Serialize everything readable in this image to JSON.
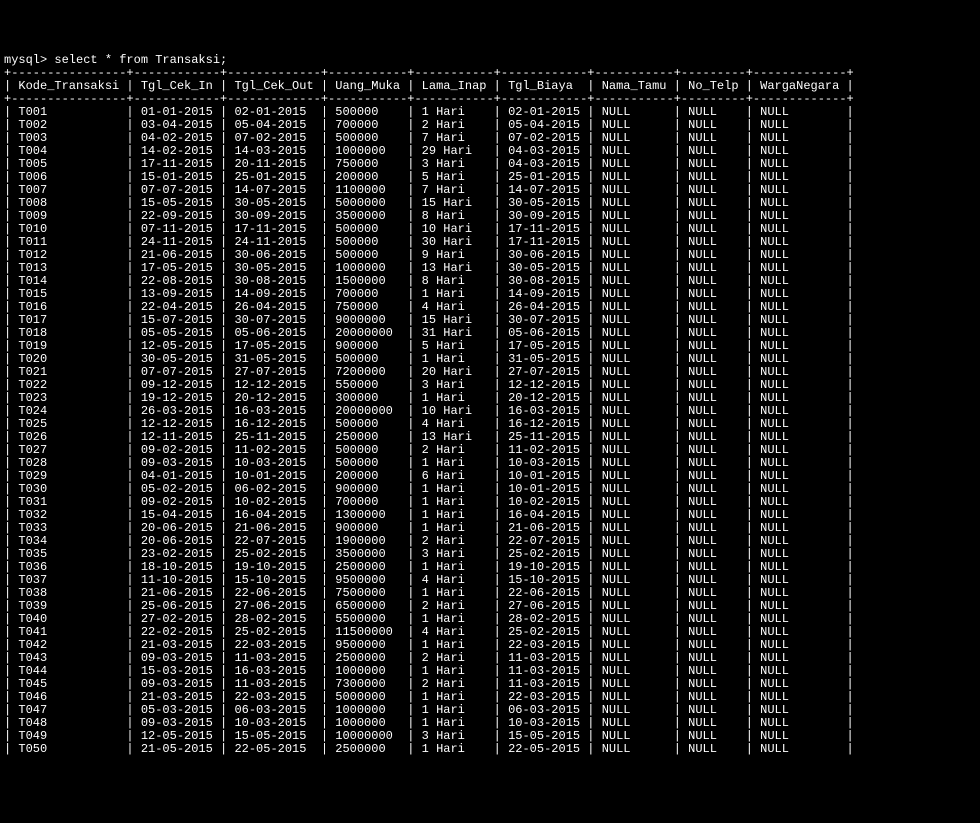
{
  "prompt": "mysql> ",
  "query": "select * from Transaksi;",
  "sep_top": "+----------------+------------+-------------+-----------+-----------+------------+-----------+---------+-------------+",
  "headers": [
    "Kode_Transaksi",
    "Tgl_Cek_In",
    "Tgl_Cek_Out",
    "Uang_Muka",
    "Lama_Inap",
    "Tgl_Biaya",
    "Nama_Tamu",
    "No_Telp",
    "WargaNegara"
  ],
  "chart_data": {
    "type": "table",
    "columns": [
      "Kode_Transaksi",
      "Tgl_Cek_In",
      "Tgl_Cek_Out",
      "Uang_Muka",
      "Lama_Inap",
      "Tgl_Biaya",
      "Nama_Tamu",
      "No_Telp",
      "WargaNegara"
    ],
    "rows": [
      [
        "T001",
        "01-01-2015",
        "02-01-2015",
        "500000",
        "1 Hari",
        "02-01-2015",
        "NULL",
        "NULL",
        "NULL"
      ],
      [
        "T002",
        "03-04-2015",
        "05-04-2015",
        "700000",
        "2 Hari",
        "05-04-2015",
        "NULL",
        "NULL",
        "NULL"
      ],
      [
        "T003",
        "04-02-2015",
        "07-02-2015",
        "500000",
        "7 Hari",
        "07-02-2015",
        "NULL",
        "NULL",
        "NULL"
      ],
      [
        "T004",
        "14-02-2015",
        "14-03-2015",
        "1000000",
        "29 Hari",
        "04-03-2015",
        "NULL",
        "NULL",
        "NULL"
      ],
      [
        "T005",
        "17-11-2015",
        "20-11-2015",
        "750000",
        "3 Hari",
        "04-03-2015",
        "NULL",
        "NULL",
        "NULL"
      ],
      [
        "T006",
        "15-01-2015",
        "25-01-2015",
        "200000",
        "5 Hari",
        "25-01-2015",
        "NULL",
        "NULL",
        "NULL"
      ],
      [
        "T007",
        "07-07-2015",
        "14-07-2015",
        "1100000",
        "7 Hari",
        "14-07-2015",
        "NULL",
        "NULL",
        "NULL"
      ],
      [
        "T008",
        "15-05-2015",
        "30-05-2015",
        "5000000",
        "15 Hari",
        "30-05-2015",
        "NULL",
        "NULL",
        "NULL"
      ],
      [
        "T009",
        "22-09-2015",
        "30-09-2015",
        "3500000",
        "8 Hari",
        "30-09-2015",
        "NULL",
        "NULL",
        "NULL"
      ],
      [
        "T010",
        "07-11-2015",
        "17-11-2015",
        "500000",
        "10 Hari",
        "17-11-2015",
        "NULL",
        "NULL",
        "NULL"
      ],
      [
        "T011",
        "24-11-2015",
        "24-11-2015",
        "500000",
        "30 Hari",
        "17-11-2015",
        "NULL",
        "NULL",
        "NULL"
      ],
      [
        "T012",
        "21-06-2015",
        "30-06-2015",
        "500000",
        "9 Hari",
        "30-06-2015",
        "NULL",
        "NULL",
        "NULL"
      ],
      [
        "T013",
        "17-05-2015",
        "30-05-2015",
        "1000000",
        "13 Hari",
        "30-05-2015",
        "NULL",
        "NULL",
        "NULL"
      ],
      [
        "T014",
        "22-08-2015",
        "30-08-2015",
        "1500000",
        "8 Hari",
        "30-08-2015",
        "NULL",
        "NULL",
        "NULL"
      ],
      [
        "T015",
        "13-09-2015",
        "14-09-2015",
        "700000",
        "1 Hari",
        "14-09-2015",
        "NULL",
        "NULL",
        "NULL"
      ],
      [
        "T016",
        "22-04-2015",
        "26-04-2015",
        "750000",
        "4 Hari",
        "26-04-2015",
        "NULL",
        "NULL",
        "NULL"
      ],
      [
        "T017",
        "15-07-2015",
        "30-07-2015",
        "9000000",
        "15 Hari",
        "30-07-2015",
        "NULL",
        "NULL",
        "NULL"
      ],
      [
        "T018",
        "05-05-2015",
        "05-06-2015",
        "20000000",
        "31 Hari",
        "05-06-2015",
        "NULL",
        "NULL",
        "NULL"
      ],
      [
        "T019",
        "12-05-2015",
        "17-05-2015",
        "900000",
        "5 Hari",
        "17-05-2015",
        "NULL",
        "NULL",
        "NULL"
      ],
      [
        "T020",
        "30-05-2015",
        "31-05-2015",
        "500000",
        "1 Hari",
        "31-05-2015",
        "NULL",
        "NULL",
        "NULL"
      ],
      [
        "T021",
        "07-07-2015",
        "27-07-2015",
        "7200000",
        "20 Hari",
        "27-07-2015",
        "NULL",
        "NULL",
        "NULL"
      ],
      [
        "T022",
        "09-12-2015",
        "12-12-2015",
        "550000",
        "3 Hari",
        "12-12-2015",
        "NULL",
        "NULL",
        "NULL"
      ],
      [
        "T023",
        "19-12-2015",
        "20-12-2015",
        "300000",
        "1 Hari",
        "20-12-2015",
        "NULL",
        "NULL",
        "NULL"
      ],
      [
        "T024",
        "26-03-2015",
        "16-03-2015",
        "20000000",
        "10 Hari",
        "16-03-2015",
        "NULL",
        "NULL",
        "NULL"
      ],
      [
        "T025",
        "12-12-2015",
        "16-12-2015",
        "500000",
        "4 Hari",
        "16-12-2015",
        "NULL",
        "NULL",
        "NULL"
      ],
      [
        "T026",
        "12-11-2015",
        "25-11-2015",
        "250000",
        "13 Hari",
        "25-11-2015",
        "NULL",
        "NULL",
        "NULL"
      ],
      [
        "T027",
        "09-02-2015",
        "11-02-2015",
        "500000",
        "2 Hari",
        "11-02-2015",
        "NULL",
        "NULL",
        "NULL"
      ],
      [
        "T028",
        "09-03-2015",
        "10-03-2015",
        "500000",
        "1 Hari",
        "10-03-2015",
        "NULL",
        "NULL",
        "NULL"
      ],
      [
        "T029",
        "04-01-2015",
        "10-01-2015",
        "200000",
        "6 Hari",
        "10-01-2015",
        "NULL",
        "NULL",
        "NULL"
      ],
      [
        "T030",
        "05-02-2015",
        "06-02-2015",
        "900000",
        "1 Hari",
        "10-01-2015",
        "NULL",
        "NULL",
        "NULL"
      ],
      [
        "T031",
        "09-02-2015",
        "10-02-2015",
        "700000",
        "1 Hari",
        "10-02-2015",
        "NULL",
        "NULL",
        "NULL"
      ],
      [
        "T032",
        "15-04-2015",
        "16-04-2015",
        "1300000",
        "1 Hari",
        "16-04-2015",
        "NULL",
        "NULL",
        "NULL"
      ],
      [
        "T033",
        "20-06-2015",
        "21-06-2015",
        "900000",
        "1 Hari",
        "21-06-2015",
        "NULL",
        "NULL",
        "NULL"
      ],
      [
        "T034",
        "20-06-2015",
        "22-07-2015",
        "1900000",
        "2 Hari",
        "22-07-2015",
        "NULL",
        "NULL",
        "NULL"
      ],
      [
        "T035",
        "23-02-2015",
        "25-02-2015",
        "3500000",
        "3 Hari",
        "25-02-2015",
        "NULL",
        "NULL",
        "NULL"
      ],
      [
        "T036",
        "18-10-2015",
        "19-10-2015",
        "2500000",
        "1 Hari",
        "19-10-2015",
        "NULL",
        "NULL",
        "NULL"
      ],
      [
        "T037",
        "11-10-2015",
        "15-10-2015",
        "9500000",
        "4 Hari",
        "15-10-2015",
        "NULL",
        "NULL",
        "NULL"
      ],
      [
        "T038",
        "21-06-2015",
        "22-06-2015",
        "7500000",
        "1 Hari",
        "22-06-2015",
        "NULL",
        "NULL",
        "NULL"
      ],
      [
        "T039",
        "25-06-2015",
        "27-06-2015",
        "6500000",
        "2 Hari",
        "27-06-2015",
        "NULL",
        "NULL",
        "NULL"
      ],
      [
        "T040",
        "27-02-2015",
        "28-02-2015",
        "5500000",
        "1 Hari",
        "28-02-2015",
        "NULL",
        "NULL",
        "NULL"
      ],
      [
        "T041",
        "22-02-2015",
        "25-02-2015",
        "11500000",
        "4 Hari",
        "25-02-2015",
        "NULL",
        "NULL",
        "NULL"
      ],
      [
        "T042",
        "21-03-2015",
        "22-03-2015",
        "9500000",
        "1 Hari",
        "22-03-2015",
        "NULL",
        "NULL",
        "NULL"
      ],
      [
        "T043",
        "09-03-2015",
        "11-03-2015",
        "2500000",
        "2 Hari",
        "11-03-2015",
        "NULL",
        "NULL",
        "NULL"
      ],
      [
        "T044",
        "15-03-2015",
        "16-03-2015",
        "1000000",
        "1 Hari",
        "11-03-2015",
        "NULL",
        "NULL",
        "NULL"
      ],
      [
        "T045",
        "09-03-2015",
        "11-03-2015",
        "7300000",
        "2 Hari",
        "11-03-2015",
        "NULL",
        "NULL",
        "NULL"
      ],
      [
        "T046",
        "21-03-2015",
        "22-03-2015",
        "5000000",
        "1 Hari",
        "22-03-2015",
        "NULL",
        "NULL",
        "NULL"
      ],
      [
        "T047",
        "05-03-2015",
        "06-03-2015",
        "1000000",
        "1 Hari",
        "06-03-2015",
        "NULL",
        "NULL",
        "NULL"
      ],
      [
        "T048",
        "09-03-2015",
        "10-03-2015",
        "1000000",
        "1 Hari",
        "10-03-2015",
        "NULL",
        "NULL",
        "NULL"
      ],
      [
        "T049",
        "12-05-2015",
        "15-05-2015",
        "10000000",
        "3 Hari",
        "15-05-2015",
        "NULL",
        "NULL",
        "NULL"
      ],
      [
        "T050",
        "21-05-2015",
        "22-05-2015",
        "2500000",
        "1 Hari",
        "22-05-2015",
        "NULL",
        "NULL",
        "NULL"
      ]
    ]
  }
}
